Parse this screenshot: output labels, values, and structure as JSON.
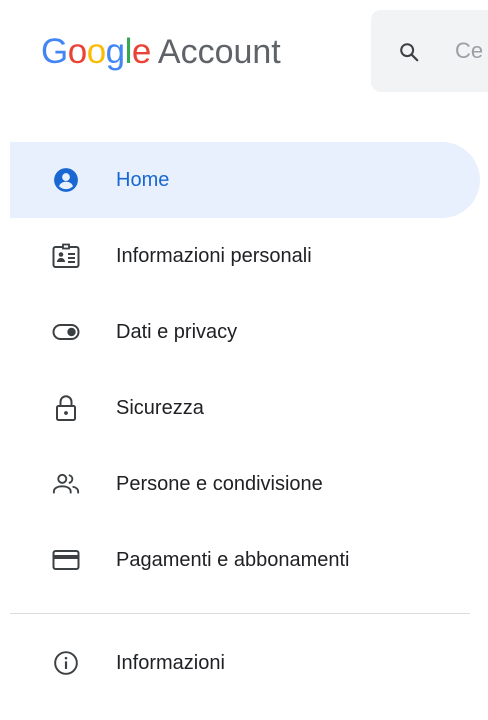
{
  "header": {
    "logo_letters": [
      "G",
      "o",
      "o",
      "g",
      "l",
      "e"
    ],
    "logo_colors": [
      "#4285F4",
      "#EA4335",
      "#FBBC05",
      "#4285F4",
      "#34A853",
      "#EA4335"
    ],
    "product_name": "Account",
    "search_placeholder": "Ce"
  },
  "nav": {
    "items": [
      {
        "label": "Home",
        "icon": "account-circle-icon",
        "active": true
      },
      {
        "label": "Informazioni personali",
        "icon": "id-card-icon",
        "active": false
      },
      {
        "label": "Dati e privacy",
        "icon": "toggle-icon",
        "active": false
      },
      {
        "label": "Sicurezza",
        "icon": "lock-icon",
        "active": false
      },
      {
        "label": "Persone e condivisione",
        "icon": "people-icon",
        "active": false
      },
      {
        "label": "Pagamenti e abbonamenti",
        "icon": "credit-card-icon",
        "active": false
      }
    ],
    "about": {
      "label": "Informazioni",
      "icon": "info-icon"
    }
  },
  "colors": {
    "accent": "#1967d2",
    "active_background": "#e8f0fe",
    "icon_gray": "#3c4043",
    "text": "#202124"
  }
}
